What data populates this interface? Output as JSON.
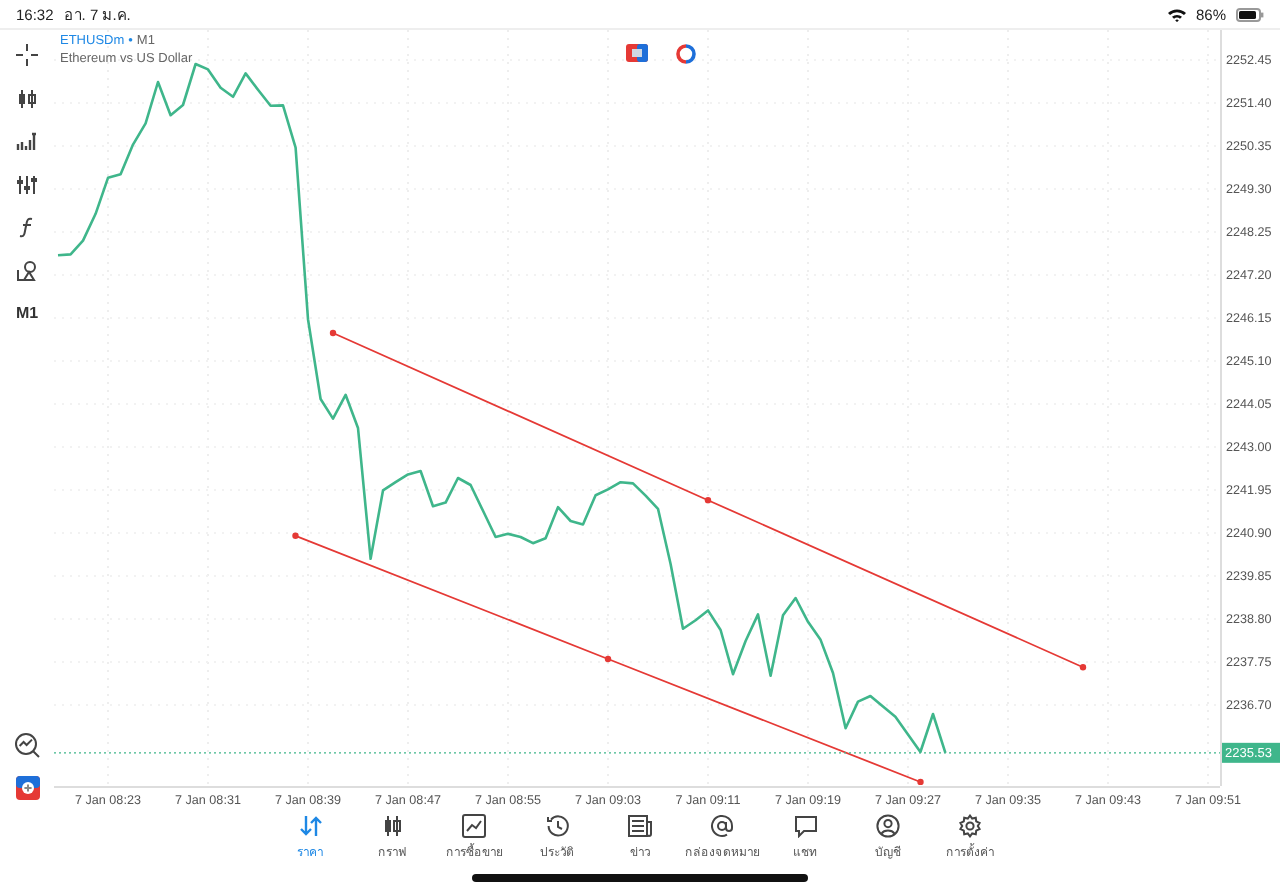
{
  "status_bar": {
    "time": "16:32",
    "date": "อา. 7 ม.ค.",
    "battery": "86%"
  },
  "symbol": {
    "name": "ETHUSDm",
    "separator": "•",
    "timeframe": "M1",
    "description": "Ethereum vs US Dollar"
  },
  "left_toolbar": {
    "timeframe_button": "M1"
  },
  "chart": {
    "chart_data": {
      "type": "line",
      "grid": true,
      "ylim": [
        2234.72,
        2253.18
      ],
      "ref_lines": [
        {
          "axis": "y",
          "value": 2235.53,
          "label": "2235.53",
          "color": "#3fb68b"
        }
      ],
      "categories": [
        null,
        null,
        null,
        null,
        "7 Jan 08:23",
        null,
        null,
        null,
        null,
        null,
        null,
        null,
        "7 Jan 08:31",
        null,
        null,
        null,
        null,
        null,
        null,
        null,
        "7 Jan 08:39",
        null,
        null,
        null,
        null,
        null,
        null,
        null,
        "7 Jan 08:47",
        null,
        null,
        null,
        null,
        null,
        null,
        null,
        "7 Jan 08:55",
        null,
        null,
        null,
        null,
        null,
        null,
        null,
        "7 Jan 09:03",
        null,
        null,
        null,
        null,
        null,
        null,
        null,
        "7 Jan 09:11",
        null,
        null,
        null,
        null,
        null,
        null,
        null,
        "7 Jan 09:19",
        null,
        null,
        null,
        null,
        null,
        null,
        null,
        "7 Jan 09:27",
        null,
        null,
        null,
        null,
        null,
        null,
        null,
        "7 Jan 09:35",
        null,
        null,
        null,
        null,
        null,
        null,
        null,
        "7 Jan 09:43",
        null,
        null,
        null,
        null,
        null,
        null,
        null,
        "7 Jan 09:51"
      ],
      "yticks": [
        {
          "value": 2252.45,
          "label": "2252.45"
        },
        {
          "value": 2251.4,
          "label": "2251.40"
        },
        {
          "value": 2250.35,
          "label": "2250.35"
        },
        {
          "value": 2249.3,
          "label": "2249.30"
        },
        {
          "value": 2248.25,
          "label": "2248.25"
        },
        {
          "value": 2247.2,
          "label": "2247.20"
        },
        {
          "value": 2246.15,
          "label": "2246.15"
        },
        {
          "value": 2245.1,
          "label": "2245.10"
        },
        {
          "value": 2244.05,
          "label": "2244.05"
        },
        {
          "value": 2243.0,
          "label": "2243.00"
        },
        {
          "value": 2241.95,
          "label": "2241.95"
        },
        {
          "value": 2240.9,
          "label": "2240.90"
        },
        {
          "value": 2239.85,
          "label": "2239.85"
        },
        {
          "value": 2238.8,
          "label": "2238.80"
        },
        {
          "value": 2237.75,
          "label": "2237.75"
        },
        {
          "value": 2236.7,
          "label": "2236.70"
        }
      ],
      "series": [
        {
          "color": "#3fb68b",
          "values": [
            2247.68,
            2247.7,
            2248.04,
            2248.69,
            2249.57,
            2249.66,
            2250.38,
            2250.9,
            2251.91,
            2251.1,
            2251.35,
            2252.35,
            2252.22,
            2251.77,
            2251.55,
            2252.12,
            2251.72,
            2251.33,
            2251.34,
            2250.31,
            2246.12,
            2244.17,
            2243.69,
            2244.27,
            2243.46,
            2240.27,
            2241.94,
            2242.14,
            2242.33,
            2242.41,
            2241.55,
            2241.64,
            2242.24,
            2242.07,
            2241.44,
            2240.8,
            2240.88,
            2240.8,
            2240.65,
            2240.77,
            2241.53,
            2241.19,
            2241.11,
            2241.82,
            2241.96,
            2242.14,
            2242.11,
            2241.81,
            2241.49,
            2240.14,
            2238.56,
            2238.77,
            2239.01,
            2238.53,
            2237.45,
            2238.26,
            2238.91,
            2237.41,
            2238.89,
            2239.31,
            2238.73,
            2238.3,
            2237.48,
            2236.13,
            2236.78,
            2236.92,
            2236.66,
            2236.41,
            2235.98,
            2235.55,
            2236.48,
            2235.53,
            null,
            null,
            null,
            null,
            null,
            null,
            null,
            null,
            null,
            null,
            null,
            null,
            null,
            null,
            null,
            null,
            null,
            null,
            null,
            null,
            null
          ]
        },
        {
          "color": "#e53935",
          "marker": "circle",
          "values": [
            null,
            null,
            null,
            null,
            null,
            null,
            null,
            null,
            null,
            null,
            null,
            null,
            null,
            null,
            null,
            null,
            null,
            null,
            null,
            null,
            null,
            null,
            2245.78,
            null,
            null,
            null,
            null,
            null,
            null,
            null,
            null,
            null,
            null,
            null,
            null,
            null,
            null,
            null,
            null,
            null,
            null,
            null,
            null,
            null,
            null,
            null,
            null,
            null,
            null,
            null,
            null,
            null,
            2241.7,
            null,
            null,
            null,
            null,
            null,
            null,
            null,
            null,
            null,
            null,
            null,
            null,
            null,
            null,
            null,
            null,
            null,
            null,
            null,
            null,
            null,
            null,
            null,
            null,
            null,
            null,
            null,
            null,
            null,
            2237.62,
            null,
            null,
            null,
            null,
            null,
            null,
            null,
            null,
            null,
            null
          ]
        },
        {
          "color": "#e53935",
          "marker": "circle",
          "values": [
            null,
            null,
            null,
            null,
            null,
            null,
            null,
            null,
            null,
            null,
            null,
            null,
            null,
            null,
            null,
            null,
            null,
            null,
            null,
            2240.83,
            null,
            null,
            null,
            null,
            null,
            null,
            null,
            null,
            null,
            null,
            null,
            null,
            null,
            null,
            null,
            null,
            null,
            null,
            null,
            null,
            null,
            null,
            null,
            null,
            2237.82,
            null,
            null,
            null,
            null,
            null,
            null,
            null,
            null,
            null,
            null,
            null,
            null,
            null,
            null,
            null,
            null,
            null,
            null,
            null,
            null,
            null,
            null,
            null,
            null,
            2234.82,
            null,
            null,
            null,
            null,
            null,
            null,
            null,
            null,
            null,
            null,
            null,
            null,
            null,
            null,
            null,
            null,
            null,
            null,
            null,
            null,
            null,
            null,
            null
          ]
        }
      ]
    }
  },
  "bottom_nav": [
    {
      "label": "ราคา",
      "selected": true
    },
    {
      "label": "กราฟ",
      "selected": false
    },
    {
      "label": "การซื้อขาย",
      "selected": false
    },
    {
      "label": "ประวัติ",
      "selected": false
    },
    {
      "label": "ข่าว",
      "selected": false
    },
    {
      "label": "กล่องจดหมาย",
      "selected": false
    },
    {
      "label": "แชท",
      "selected": false
    },
    {
      "label": "บัญชี",
      "selected": false
    },
    {
      "label": "การตั้งค่า",
      "selected": false
    }
  ]
}
